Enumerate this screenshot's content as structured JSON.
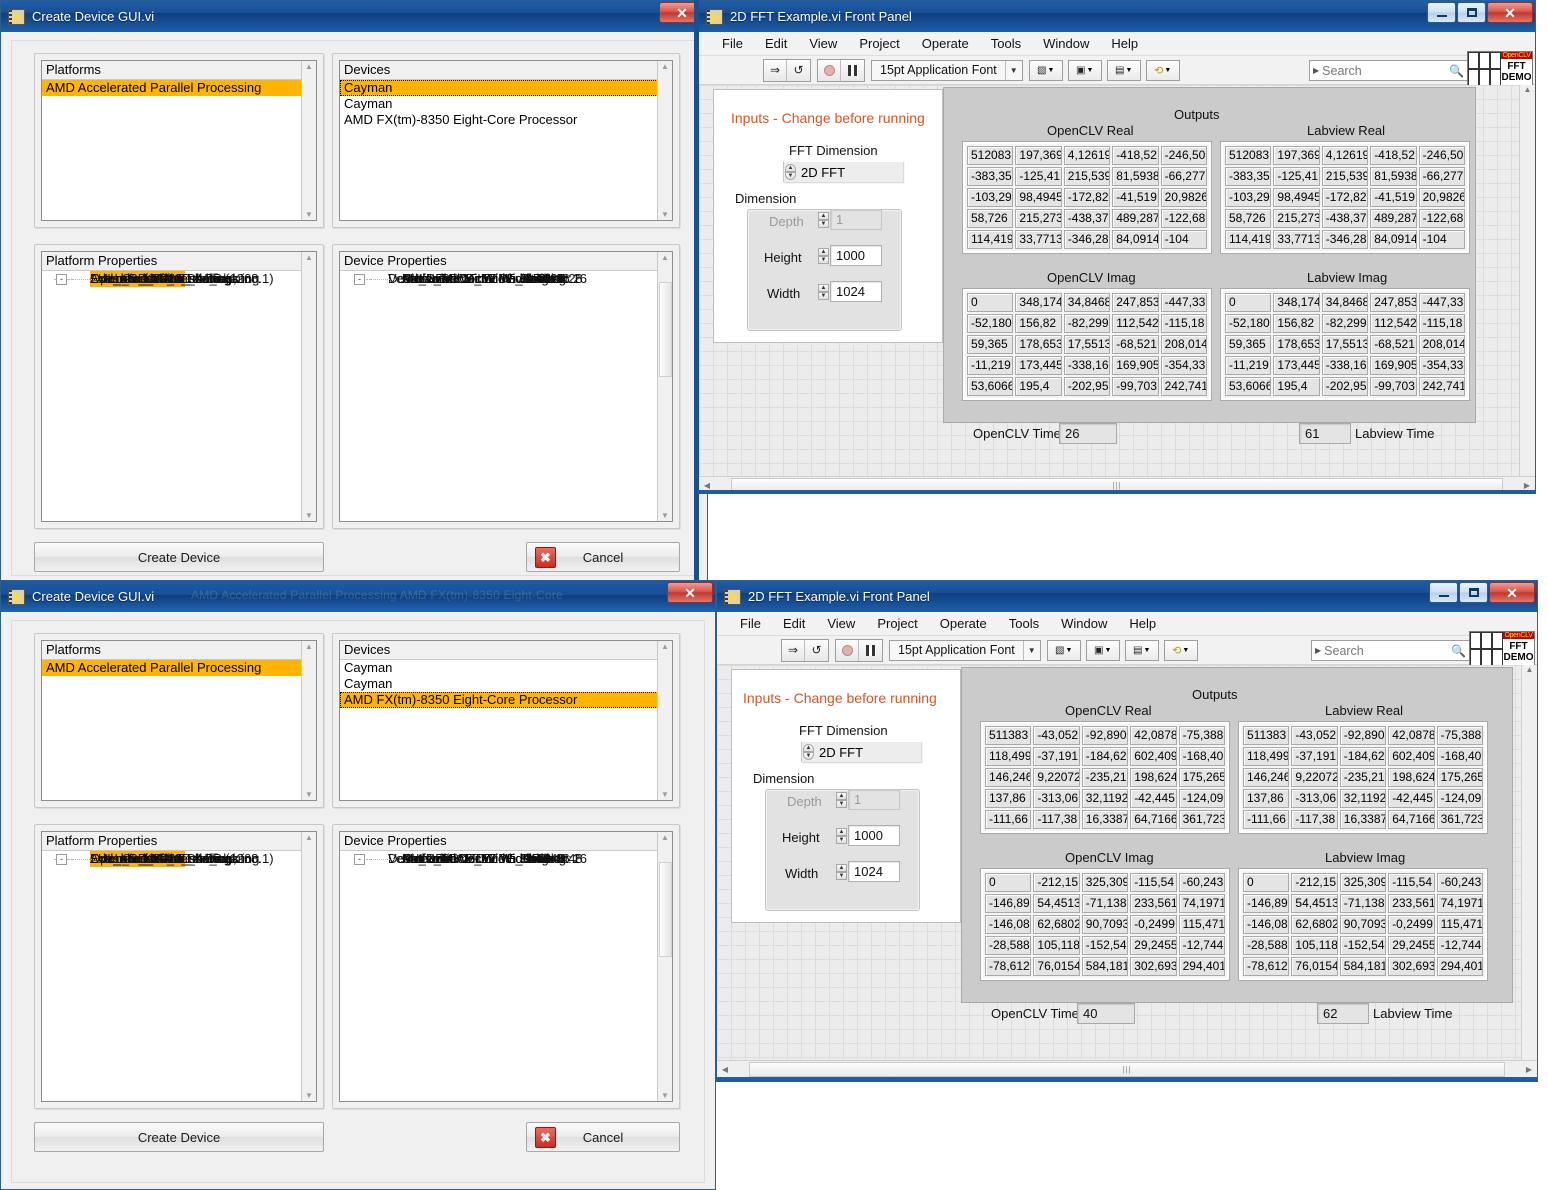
{
  "windows": {
    "create_device_1": {
      "title": "Create Device GUI.vi",
      "icon": "labview-vi-icon",
      "close_label": "✕",
      "platforms": {
        "header": "Platforms",
        "items": [
          "AMD Accelerated Parallel Processing"
        ],
        "selected_index": 0
      },
      "devices": {
        "header": "Devices",
        "items": [
          "Cayman",
          "Cayman",
          "AMD FX(tm)-8350 Eight-Core Processor"
        ],
        "selected_index": 0
      },
      "platform_properties": {
        "header": "Platform Properties",
        "items": [
          {
            "label": "FULL_PROFILE",
            "depth": 1,
            "expander": "",
            "highlight": true
          },
          {
            "label": "OpenCL 1.2 AMD-APP (1268.1)",
            "depth": 1,
            "expander": "",
            "highlight": false
          },
          {
            "label": "Advanced Micro Devices, Inc.",
            "depth": 1,
            "expander": "",
            "highlight": false
          },
          {
            "label": "Extensions",
            "depth": 1,
            "expander": "-",
            "highlight": false
          },
          {
            "label": "cl_khr_icd",
            "depth": 2,
            "expander": "",
            "highlight": false
          },
          {
            "label": "cl_amd_event_callback",
            "depth": 2,
            "expander": "",
            "highlight": false
          },
          {
            "label": "cl_amd_offline_devices",
            "depth": 2,
            "expander": "",
            "highlight": false
          },
          {
            "label": "cl_khr_d3d10_sharing",
            "depth": 2,
            "expander": "",
            "highlight": false
          },
          {
            "label": "cl_khr_d3d11_sharing",
            "depth": 2,
            "expander": "",
            "highlight": false
          },
          {
            "label": "cl_khr_dx9_media_sharing",
            "depth": 2,
            "expander": "",
            "highlight": false
          }
        ]
      },
      "device_properties": {
        "header": "Device Properties",
        "items": [
          {
            "label": "Device Info",
            "depth": 1,
            "expander": "-",
            "highlight": false
          },
          {
            "label": "Advanced Micro Devices, Inc.",
            "depth": 2,
            "expander": "",
            "highlight": false
          },
          {
            "label": "FULL_PROFILE",
            "depth": 2,
            "expander": "",
            "highlight": false
          },
          {
            "label": "CL_DEVICE_TYPE_GPU",
            "depth": 2,
            "expander": "",
            "highlight": false
          },
          {
            "label": "Vector Info",
            "depth": 1,
            "expander": "-",
            "highlight": false
          },
          {
            "label": "Native Vector Width Char: 16",
            "depth": 2,
            "expander": "",
            "highlight": false
          },
          {
            "label": "Native Vector Width Short: 8",
            "depth": 2,
            "expander": "",
            "highlight": false
          },
          {
            "label": "Native Vector Width Int: 4",
            "depth": 2,
            "expander": "",
            "highlight": false
          },
          {
            "label": "Native Vector Width Long: 2",
            "depth": 2,
            "expander": "",
            "highlight": false
          },
          {
            "label": "Native Vector Width Float: 4",
            "depth": 2,
            "expander": "",
            "highlight": false
          },
          {
            "label": "Native Vector Width Double: 2",
            "depth": 2,
            "expander": "",
            "highlight": false
          },
          {
            "label": "Native Vector Width Half: 2",
            "depth": 2,
            "expander": "",
            "highlight": false
          },
          {
            "label": "Preferred Vector Width Char: 16",
            "depth": 2,
            "expander": "",
            "highlight": false
          },
          {
            "label": "Preferred Vector Width Short: 8",
            "depth": 2,
            "expander": "",
            "highlight": false
          },
          {
            "label": "Preferred Vector Width Int: 4",
            "depth": 2,
            "expander": "",
            "highlight": false
          },
          {
            "label": "Preferred Vector Width Long: 2",
            "depth": 2,
            "expander": "",
            "highlight": false
          }
        ]
      },
      "create_button": "Create Device",
      "cancel_button": "Cancel"
    },
    "create_device_2": {
      "title": "Create Device GUI.vi",
      "close_label": "✕",
      "platforms": {
        "header": "Platforms",
        "items": [
          "AMD Accelerated Parallel Processing"
        ],
        "selected_index": 0
      },
      "devices": {
        "header": "Devices",
        "items": [
          "Cayman",
          "Cayman",
          "AMD FX(tm)-8350 Eight-Core Processor"
        ],
        "selected_index": 2
      },
      "platform_properties": {
        "header": "Platform Properties",
        "items": [
          {
            "label": "FULL_PROFILE",
            "depth": 1,
            "expander": "",
            "highlight": true
          },
          {
            "label": "OpenCL 1.2 AMD-APP (1268.1)",
            "depth": 1,
            "expander": "",
            "highlight": false
          },
          {
            "label": "Advanced Micro Devices, Inc.",
            "depth": 1,
            "expander": "",
            "highlight": false
          },
          {
            "label": "Extensions",
            "depth": 1,
            "expander": "-",
            "highlight": false
          },
          {
            "label": "cl_khr_icd",
            "depth": 2,
            "expander": "",
            "highlight": false
          },
          {
            "label": "cl_amd_event_callback",
            "depth": 2,
            "expander": "",
            "highlight": false
          },
          {
            "label": "cl_amd_offline_devices",
            "depth": 2,
            "expander": "",
            "highlight": false
          },
          {
            "label": "cl_khr_d3d10_sharing",
            "depth": 2,
            "expander": "",
            "highlight": false
          },
          {
            "label": "cl_khr_d3d11_sharing",
            "depth": 2,
            "expander": "",
            "highlight": false
          },
          {
            "label": "cl_khr_dx9_media_sharing",
            "depth": 2,
            "expander": "",
            "highlight": false
          }
        ]
      },
      "device_properties": {
        "header": "Device Properties",
        "items": [
          {
            "label": "Device Info",
            "depth": 1,
            "expander": "-",
            "highlight": false
          },
          {
            "label": "AuthenticAMD",
            "depth": 2,
            "expander": "",
            "highlight": false
          },
          {
            "label": "FULL_PROFILE",
            "depth": 2,
            "expander": "",
            "highlight": false
          },
          {
            "label": "CL_DEVICE_TYPE_CPU",
            "depth": 2,
            "expander": "",
            "highlight": false
          },
          {
            "label": "Vector Info",
            "depth": 1,
            "expander": "-",
            "highlight": false
          },
          {
            "label": "Native Vector Width Char: 16",
            "depth": 2,
            "expander": "",
            "highlight": false
          },
          {
            "label": "Native Vector Width Short: 8",
            "depth": 2,
            "expander": "",
            "highlight": false
          },
          {
            "label": "Native Vector Width Int: 4",
            "depth": 2,
            "expander": "",
            "highlight": false
          },
          {
            "label": "Native Vector Width Long: 2",
            "depth": 2,
            "expander": "",
            "highlight": false
          },
          {
            "label": "Native Vector Width Float: 8",
            "depth": 2,
            "expander": "",
            "highlight": false
          },
          {
            "label": "Native Vector Width Double: 4",
            "depth": 2,
            "expander": "",
            "highlight": false
          },
          {
            "label": "Native Vector Width Half: 4",
            "depth": 2,
            "expander": "",
            "highlight": false
          },
          {
            "label": "Preferred Vector Width Char: 16",
            "depth": 2,
            "expander": "",
            "highlight": false
          },
          {
            "label": "Preferred Vector Width Short: 8",
            "depth": 2,
            "expander": "",
            "highlight": false
          },
          {
            "label": "Preferred Vector Width Int: 4",
            "depth": 2,
            "expander": "",
            "highlight": false
          },
          {
            "label": "Preferred Vector Width Long: 2",
            "depth": 2,
            "expander": "",
            "highlight": false
          }
        ]
      },
      "create_button": "Create Device",
      "cancel_button": "Cancel"
    },
    "fft_1": {
      "title": "2D FFT Example.vi Front Panel",
      "menu": [
        "File",
        "Edit",
        "View",
        "Project",
        "Operate",
        "Tools",
        "Window",
        "Help"
      ],
      "toolbar": {
        "run_icon": "run-arrow-icon",
        "run_continuous_icon": "run-continuous-icon",
        "abort_icon": "abort-stop-icon",
        "pause_icon": "pause-icon",
        "font_selector": "15pt Application Font",
        "align_icon": "align-objects-icon",
        "distribute_icon": "distribute-objects-icon",
        "resize_icon": "resize-objects-icon",
        "reorder_icon": "reorder-objects-icon",
        "search_placeholder": "Search",
        "search_icon": "magnifier-icon",
        "help_icon": "context-help-icon"
      },
      "logo": {
        "top": "OpenCLV",
        "line1": "FFT",
        "line2": "DEMO"
      },
      "inputs": {
        "title": "Inputs - Change before running",
        "fft_dimension_label": "FFT Dimension",
        "fft_dimension_value": "2D FFT",
        "dimension_label": "Dimension",
        "depth_label": "Depth",
        "depth_value": "1",
        "height_label": "Height",
        "height_value": "1000",
        "width_label": "Width",
        "width_value": "1024"
      },
      "outputs_label": "Outputs",
      "tables": [
        {
          "name": "OpenCLV Real",
          "rows": [
            [
              "512083",
              "197,369",
              "4,12619",
              "-418,52",
              "-246,50"
            ],
            [
              "-383,35",
              "-125,41",
              "215,539",
              "81,5938",
              "-66,277"
            ],
            [
              "-103,29",
              "98,4945",
              "-172,82",
              "-41,519",
              "20,9826"
            ],
            [
              "58,726",
              "215,273",
              "-438,37",
              "489,287",
              "-122,68"
            ],
            [
              "114,419",
              "33,7713",
              "-346,28",
              "84,0914",
              "-104"
            ]
          ]
        },
        {
          "name": "Labview Real",
          "rows": [
            [
              "512083",
              "197,369",
              "4,12619",
              "-418,52",
              "-246,50"
            ],
            [
              "-383,35",
              "-125,41",
              "215,539",
              "81,5938",
              "-66,277"
            ],
            [
              "-103,29",
              "98,4945",
              "-172,82",
              "-41,519",
              "20,9826"
            ],
            [
              "58,726",
              "215,273",
              "-438,37",
              "489,287",
              "-122,68"
            ],
            [
              "114,419",
              "33,7713",
              "-346,28",
              "84,0914",
              "-104"
            ]
          ]
        },
        {
          "name": "OpenCLV Imag",
          "rows": [
            [
              "0",
              "348,174",
              "34,8468",
              "247,853",
              "-447,33"
            ],
            [
              "-52,180",
              "156,82",
              "-82,299",
              "112,542",
              "-115,18"
            ],
            [
              "59,365",
              "178,653",
              "17,5513",
              "-68,521",
              "208,014"
            ],
            [
              "-11,219",
              "173,445",
              "-338,16",
              "169,905",
              "-354,33"
            ],
            [
              "53,6066",
              "195,4",
              "-202,95",
              "-99,703",
              "242,741"
            ]
          ]
        },
        {
          "name": "Labview Imag",
          "rows": [
            [
              "0",
              "348,174",
              "34,8468",
              "247,853",
              "-447,33"
            ],
            [
              "-52,180",
              "156,82",
              "-82,299",
              "112,542",
              "-115,18"
            ],
            [
              "59,365",
              "178,653",
              "17,5513",
              "-68,521",
              "208,014"
            ],
            [
              "-11,219",
              "173,445",
              "-338,16",
              "169,905",
              "-354,33"
            ],
            [
              "53,6066",
              "195,4",
              "-202,95",
              "-99,703",
              "242,741"
            ]
          ]
        }
      ],
      "opencl_time_label": "OpenCLV Time",
      "opencl_time_value": "26",
      "labview_time_label": "Labview Time",
      "labview_time_value": "61"
    },
    "fft_2": {
      "title": "2D FFT Example.vi Front Panel",
      "menu": [
        "File",
        "Edit",
        "View",
        "Project",
        "Operate",
        "Tools",
        "Window",
        "Help"
      ],
      "toolbar": {
        "font_selector": "15pt Application Font",
        "search_placeholder": "Search"
      },
      "logo": {
        "top": "OpenCLV",
        "line1": "FFT",
        "line2": "DEMO"
      },
      "inputs": {
        "title": "Inputs - Change before running",
        "fft_dimension_label": "FFT Dimension",
        "fft_dimension_value": "2D FFT",
        "dimension_label": "Dimension",
        "depth_label": "Depth",
        "depth_value": "1",
        "height_label": "Height",
        "height_value": "1000",
        "width_label": "Width",
        "width_value": "1024"
      },
      "outputs_label": "Outputs",
      "tables": [
        {
          "name": "OpenCLV Real",
          "rows": [
            [
              "511383",
              "-43,052",
              "-92,890",
              "42,0878",
              "-75,388"
            ],
            [
              "118,499",
              "-37,191",
              "-184,62",
              "602,409",
              "-168,40"
            ],
            [
              "146,246",
              "9,22072",
              "-235,21",
              "198,624",
              "175,265"
            ],
            [
              "137,86",
              "-313,06",
              "32,1192",
              "-42,445",
              "-124,09"
            ],
            [
              "-111,66",
              "-117,38",
              "16,3387",
              "64,7166",
              "361,723"
            ]
          ]
        },
        {
          "name": "Labview Real",
          "rows": [
            [
              "511383",
              "-43,052",
              "-92,890",
              "42,0878",
              "-75,388"
            ],
            [
              "118,499",
              "-37,191",
              "-184,62",
              "602,409",
              "-168,40"
            ],
            [
              "146,246",
              "9,22072",
              "-235,21",
              "198,624",
              "175,265"
            ],
            [
              "137,86",
              "-313,06",
              "32,1192",
              "-42,445",
              "-124,09"
            ],
            [
              "-111,66",
              "-117,38",
              "16,3387",
              "64,7166",
              "361,723"
            ]
          ]
        },
        {
          "name": "OpenCLV Imag",
          "rows": [
            [
              "0",
              "-212,15",
              "325,309",
              "-115,54",
              "-60,243"
            ],
            [
              "-146,89",
              "54,4513",
              "-71,138",
              "233,561",
              "74,1971"
            ],
            [
              "-146,08",
              "62,6802",
              "90,7093",
              "-0,2499",
              "115,471"
            ],
            [
              "-28,588",
              "105,118",
              "-152,54",
              "29,2455",
              "-12,744"
            ],
            [
              "-78,612",
              "76,0154",
              "584,181",
              "302,693",
              "294,401"
            ]
          ]
        },
        {
          "name": "Labview Imag",
          "rows": [
            [
              "0",
              "-212,15",
              "325,309",
              "-115,54",
              "-60,243"
            ],
            [
              "-146,89",
              "54,4513",
              "-71,138",
              "233,561",
              "74,1971"
            ],
            [
              "-146,08",
              "62,6802",
              "90,7093",
              "-0,2499",
              "115,471"
            ],
            [
              "-28,588",
              "105,118",
              "-152,54",
              "29,2455",
              "-12,744"
            ],
            [
              "-78,612",
              "76,0154",
              "584,181",
              "302,693",
              "294,401"
            ]
          ]
        }
      ],
      "opencl_time_label": "OpenCLV Time",
      "opencl_time_value": "40",
      "labview_time_label": "Labview Time",
      "labview_time_value": "62"
    }
  },
  "colors": {
    "selection": "#ffb400",
    "title_accent": "#e2521f",
    "titlebar_blue": "#1f5ca8",
    "close_red": "#c0382c"
  }
}
